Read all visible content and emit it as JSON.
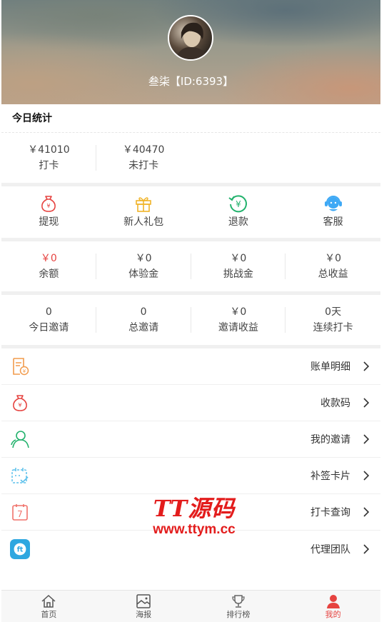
{
  "profile": {
    "name": "叁柒【ID:6393】"
  },
  "today_stats": {
    "title": "今日统计",
    "items": [
      {
        "value": "￥41010",
        "label": "打卡"
      },
      {
        "value": "￥40470",
        "label": "未打卡"
      }
    ]
  },
  "actions": [
    {
      "label": "提现",
      "icon": "money-bag-icon"
    },
    {
      "label": "新人礼包",
      "icon": "gift-icon"
    },
    {
      "label": "退款",
      "icon": "refund-icon"
    },
    {
      "label": "客服",
      "icon": "headset-icon"
    }
  ],
  "balances": [
    {
      "value": "￥0",
      "label": "余额"
    },
    {
      "value": "￥0",
      "label": "体验金"
    },
    {
      "value": "￥0",
      "label": "挑战金"
    },
    {
      "value": "￥0",
      "label": "总收益"
    }
  ],
  "invites": [
    {
      "value": "0",
      "label": "今日邀请"
    },
    {
      "value": "0",
      "label": "总邀请"
    },
    {
      "value": "￥0",
      "label": "邀请收益"
    },
    {
      "value": "0天",
      "label": "连续打卡"
    }
  ],
  "menu": [
    {
      "label": "账单明细",
      "icon": "bill-icon"
    },
    {
      "label": "收款码",
      "icon": "money-bag-icon"
    },
    {
      "label": "我的邀请",
      "icon": "users-icon"
    },
    {
      "label": "补签卡片",
      "icon": "calendar-check-icon"
    },
    {
      "label": "打卡查询",
      "icon": "calendar-7-icon"
    },
    {
      "label": "代理团队",
      "icon": "team-badge-icon"
    }
  ],
  "watermark": {
    "line1": "TT源码",
    "line2": "www.ttym.cc"
  },
  "tabbar": [
    {
      "label": "首页",
      "icon": "home-icon"
    },
    {
      "label": "海报",
      "icon": "image-icon"
    },
    {
      "label": "排行榜",
      "icon": "trophy-icon"
    },
    {
      "label": "我的",
      "icon": "user-icon"
    }
  ],
  "colors": {
    "accent": "#e64340",
    "icon_orange": "#f29b4c",
    "icon_green": "#23b26d",
    "icon_blue": "#3fa9f5"
  }
}
